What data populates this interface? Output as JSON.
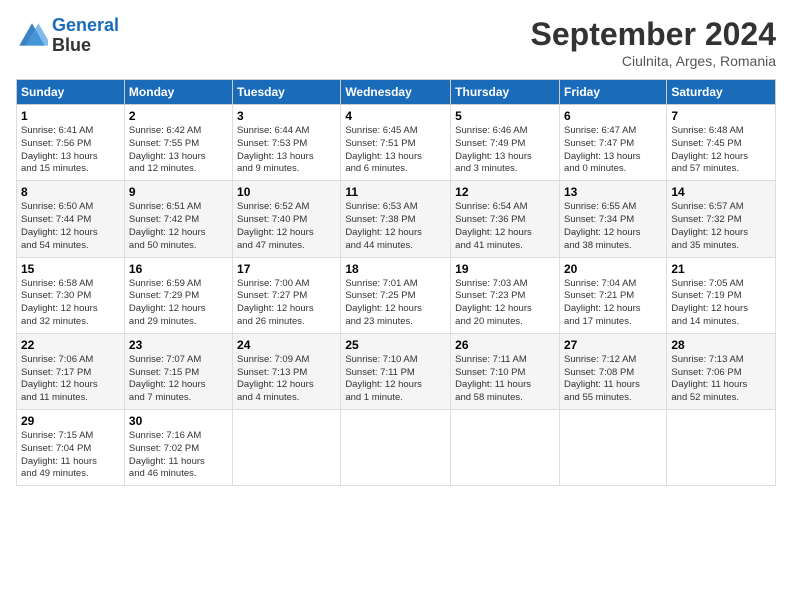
{
  "header": {
    "logo_line1": "General",
    "logo_line2": "Blue",
    "month": "September 2024",
    "location": "Ciulnita, Arges, Romania"
  },
  "weekdays": [
    "Sunday",
    "Monday",
    "Tuesday",
    "Wednesday",
    "Thursday",
    "Friday",
    "Saturday"
  ],
  "weeks": [
    [
      {
        "day": "1",
        "info": "Sunrise: 6:41 AM\nSunset: 7:56 PM\nDaylight: 13 hours\nand 15 minutes."
      },
      {
        "day": "2",
        "info": "Sunrise: 6:42 AM\nSunset: 7:55 PM\nDaylight: 13 hours\nand 12 minutes."
      },
      {
        "day": "3",
        "info": "Sunrise: 6:44 AM\nSunset: 7:53 PM\nDaylight: 13 hours\nand 9 minutes."
      },
      {
        "day": "4",
        "info": "Sunrise: 6:45 AM\nSunset: 7:51 PM\nDaylight: 13 hours\nand 6 minutes."
      },
      {
        "day": "5",
        "info": "Sunrise: 6:46 AM\nSunset: 7:49 PM\nDaylight: 13 hours\nand 3 minutes."
      },
      {
        "day": "6",
        "info": "Sunrise: 6:47 AM\nSunset: 7:47 PM\nDaylight: 13 hours\nand 0 minutes."
      },
      {
        "day": "7",
        "info": "Sunrise: 6:48 AM\nSunset: 7:45 PM\nDaylight: 12 hours\nand 57 minutes."
      }
    ],
    [
      {
        "day": "8",
        "info": "Sunrise: 6:50 AM\nSunset: 7:44 PM\nDaylight: 12 hours\nand 54 minutes."
      },
      {
        "day": "9",
        "info": "Sunrise: 6:51 AM\nSunset: 7:42 PM\nDaylight: 12 hours\nand 50 minutes."
      },
      {
        "day": "10",
        "info": "Sunrise: 6:52 AM\nSunset: 7:40 PM\nDaylight: 12 hours\nand 47 minutes."
      },
      {
        "day": "11",
        "info": "Sunrise: 6:53 AM\nSunset: 7:38 PM\nDaylight: 12 hours\nand 44 minutes."
      },
      {
        "day": "12",
        "info": "Sunrise: 6:54 AM\nSunset: 7:36 PM\nDaylight: 12 hours\nand 41 minutes."
      },
      {
        "day": "13",
        "info": "Sunrise: 6:55 AM\nSunset: 7:34 PM\nDaylight: 12 hours\nand 38 minutes."
      },
      {
        "day": "14",
        "info": "Sunrise: 6:57 AM\nSunset: 7:32 PM\nDaylight: 12 hours\nand 35 minutes."
      }
    ],
    [
      {
        "day": "15",
        "info": "Sunrise: 6:58 AM\nSunset: 7:30 PM\nDaylight: 12 hours\nand 32 minutes."
      },
      {
        "day": "16",
        "info": "Sunrise: 6:59 AM\nSunset: 7:29 PM\nDaylight: 12 hours\nand 29 minutes."
      },
      {
        "day": "17",
        "info": "Sunrise: 7:00 AM\nSunset: 7:27 PM\nDaylight: 12 hours\nand 26 minutes."
      },
      {
        "day": "18",
        "info": "Sunrise: 7:01 AM\nSunset: 7:25 PM\nDaylight: 12 hours\nand 23 minutes."
      },
      {
        "day": "19",
        "info": "Sunrise: 7:03 AM\nSunset: 7:23 PM\nDaylight: 12 hours\nand 20 minutes."
      },
      {
        "day": "20",
        "info": "Sunrise: 7:04 AM\nSunset: 7:21 PM\nDaylight: 12 hours\nand 17 minutes."
      },
      {
        "day": "21",
        "info": "Sunrise: 7:05 AM\nSunset: 7:19 PM\nDaylight: 12 hours\nand 14 minutes."
      }
    ],
    [
      {
        "day": "22",
        "info": "Sunrise: 7:06 AM\nSunset: 7:17 PM\nDaylight: 12 hours\nand 11 minutes."
      },
      {
        "day": "23",
        "info": "Sunrise: 7:07 AM\nSunset: 7:15 PM\nDaylight: 12 hours\nand 7 minutes."
      },
      {
        "day": "24",
        "info": "Sunrise: 7:09 AM\nSunset: 7:13 PM\nDaylight: 12 hours\nand 4 minutes."
      },
      {
        "day": "25",
        "info": "Sunrise: 7:10 AM\nSunset: 7:11 PM\nDaylight: 12 hours\nand 1 minute."
      },
      {
        "day": "26",
        "info": "Sunrise: 7:11 AM\nSunset: 7:10 PM\nDaylight: 11 hours\nand 58 minutes."
      },
      {
        "day": "27",
        "info": "Sunrise: 7:12 AM\nSunset: 7:08 PM\nDaylight: 11 hours\nand 55 minutes."
      },
      {
        "day": "28",
        "info": "Sunrise: 7:13 AM\nSunset: 7:06 PM\nDaylight: 11 hours\nand 52 minutes."
      }
    ],
    [
      {
        "day": "29",
        "info": "Sunrise: 7:15 AM\nSunset: 7:04 PM\nDaylight: 11 hours\nand 49 minutes."
      },
      {
        "day": "30",
        "info": "Sunrise: 7:16 AM\nSunset: 7:02 PM\nDaylight: 11 hours\nand 46 minutes."
      },
      {
        "day": "",
        "info": ""
      },
      {
        "day": "",
        "info": ""
      },
      {
        "day": "",
        "info": ""
      },
      {
        "day": "",
        "info": ""
      },
      {
        "day": "",
        "info": ""
      }
    ]
  ]
}
